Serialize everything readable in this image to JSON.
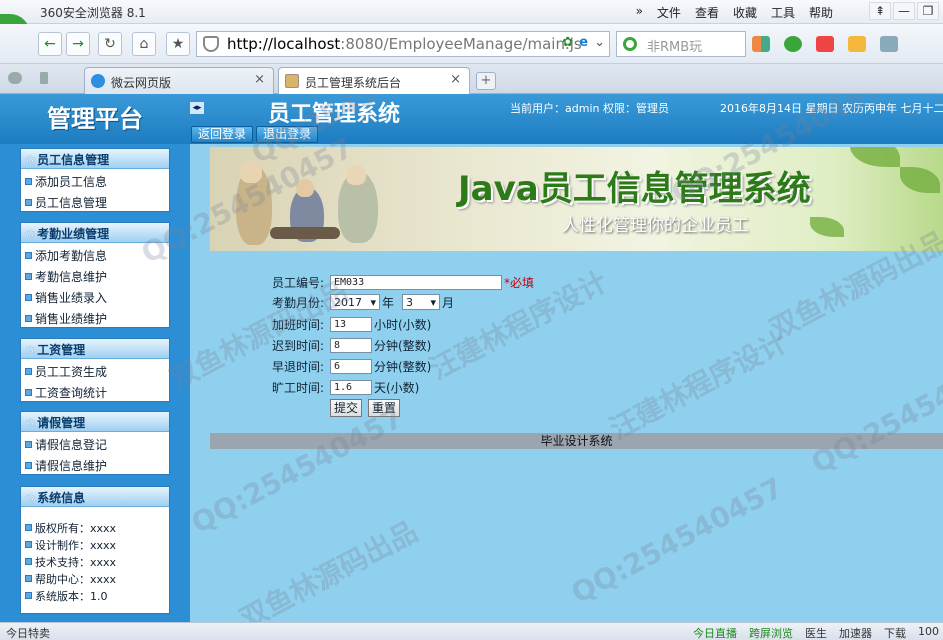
{
  "browser": {
    "app_title": "360安全浏览器 8.1",
    "menus": [
      "文件",
      "查看",
      "收藏",
      "工具",
      "帮助"
    ],
    "window_controls": [
      "⇞",
      "—",
      "❐"
    ],
    "address_host": "http://localhost",
    "address_rest": ":8080/EmployeeManage/main.js",
    "search_placeholder": "非RMB玩",
    "tabs": [
      {
        "label": "微云网页版",
        "close": "×"
      },
      {
        "label": "员工管理系统后台",
        "close": "×"
      }
    ],
    "new_tab": "+"
  },
  "header": {
    "platform": "管理平台",
    "toggle": "◂▸",
    "title": "员工管理系统",
    "user_info": "当前用户：admin 权限：管理员",
    "date": "2016年8月14日 星期日 农历丙申年 七月十二",
    "buttons": {
      "back_login": "返回登录",
      "logout": "退出登录"
    }
  },
  "sidebar": {
    "sections": [
      {
        "title": "员工信息管理",
        "items": [
          "添加员工信息",
          "员工信息管理"
        ]
      },
      {
        "title": "考勤业绩管理",
        "items": [
          "添加考勤信息",
          "考勤信息维护",
          "销售业绩录入",
          "销售业绩维护"
        ]
      },
      {
        "title": "工资管理",
        "items": [
          "员工工资生成",
          "工资查询统计"
        ]
      },
      {
        "title": "请假管理",
        "items": [
          "请假信息登记",
          "请假信息维护"
        ]
      }
    ],
    "system_info": {
      "title": "系统信息",
      "lines": [
        "版权所有：xxxx",
        "设计制作：xxxx",
        "技术支持：xxxx",
        "帮助中心：xxxx",
        "系统版本：1.0"
      ]
    }
  },
  "banner": {
    "title": "Java员工信息管理系统",
    "subtitle": "人性化管理你的企业员工"
  },
  "form": {
    "emp_no_label": "员工编号:",
    "emp_no_value": "EM033",
    "required": "*必填",
    "month_label": "考勤月份:",
    "year_value": "2017",
    "year_unit": "年",
    "month_value": "3",
    "month_unit": "月",
    "overtime_label": "加班时间:",
    "overtime_value": "13",
    "overtime_unit": "小时(小数)",
    "late_label": "迟到时间:",
    "late_value": "8",
    "late_unit": "分钟(整数)",
    "early_label": "早退时间:",
    "early_value": "6",
    "early_unit": "分钟(整数)",
    "absent_label": "旷工时间:",
    "absent_value": "1.6",
    "absent_unit": "天(小数)",
    "submit": "提交",
    "reset": "重置"
  },
  "footer": {
    "text": "毕业设计系统"
  },
  "statusbar": {
    "left": "今日特卖",
    "right": [
      "今日直播",
      "跨屏浏览",
      "医生",
      "加速器",
      "下载",
      "100"
    ]
  },
  "watermarks": [
    "QQ:254540457",
    "汪建林程序设计",
    "双鱼林源码出品"
  ]
}
